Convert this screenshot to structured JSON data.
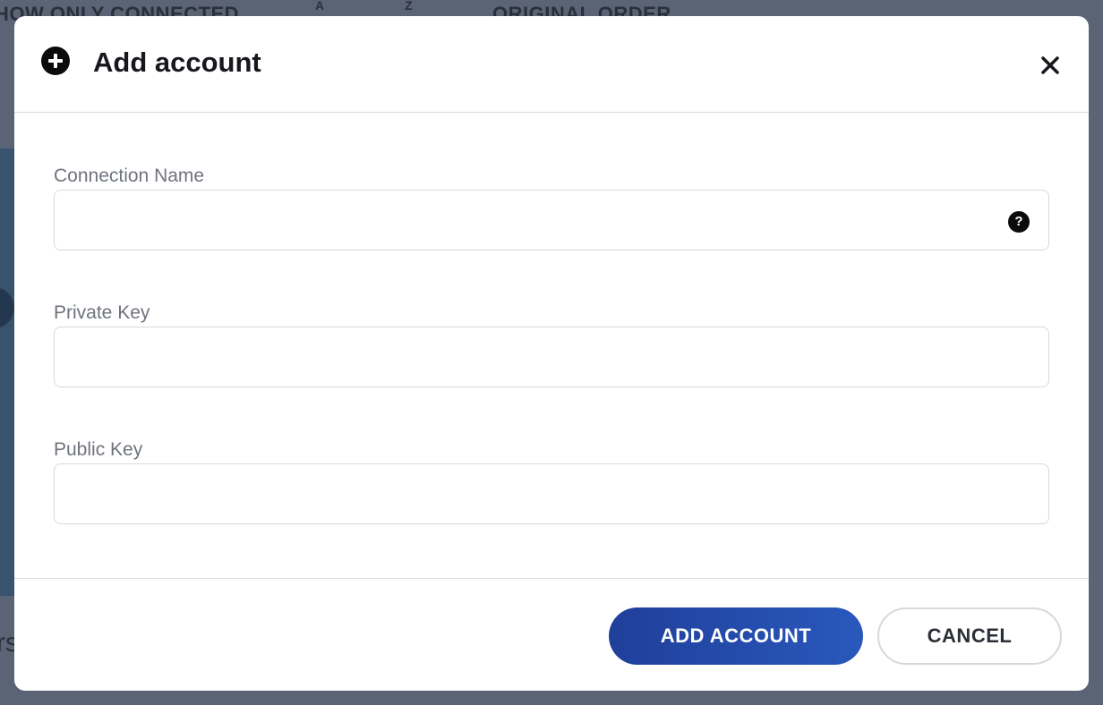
{
  "background": {
    "filter_label": "HOW ONLY CONNECTED",
    "sort_az_icon": "A",
    "sort_za_icon": "Z",
    "order_label": "ORIGINAL ORDER",
    "partial_text": "rs"
  },
  "modal": {
    "title": "Add account",
    "header_icon": "plus-circle-icon",
    "close_icon": "close-icon",
    "fields": [
      {
        "label": "Connection Name",
        "value": "",
        "placeholder": "",
        "help_icon": "?"
      },
      {
        "label": "Private Key",
        "value": "",
        "placeholder": ""
      },
      {
        "label": "Public Key",
        "value": "",
        "placeholder": ""
      }
    ],
    "buttons": {
      "primary_label": "ADD ACCOUNT",
      "secondary_label": "CANCEL"
    }
  },
  "colors": {
    "overlay": "#5b6474",
    "primary_button_start": "#1f3f9a",
    "primary_button_end": "#2a58bc",
    "label_text": "#6f737c",
    "border": "#d6d8dc"
  }
}
